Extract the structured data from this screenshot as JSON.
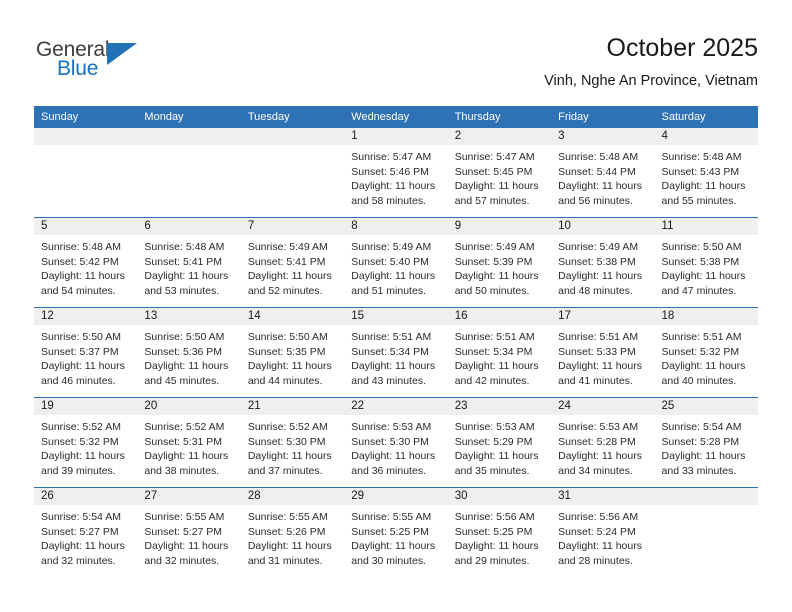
{
  "brand": {
    "name_part1": "General",
    "name_part2": "Blue"
  },
  "header": {
    "title": "October 2025",
    "location": "Vinh, Nghe An Province, Vietnam"
  },
  "colors": {
    "header_blue": "#2e71b5",
    "daynum_band": "#efefef",
    "logo_blue": "#1673c4",
    "text": "#1a1a1a"
  },
  "weekday_headers": [
    "Sunday",
    "Monday",
    "Tuesday",
    "Wednesday",
    "Thursday",
    "Friday",
    "Saturday"
  ],
  "labels": {
    "sunrise_prefix": "Sunrise:",
    "sunset_prefix": "Sunset:",
    "daylight_prefix": "Daylight:"
  },
  "weeks": [
    [
      {
        "day": "",
        "sunrise": "",
        "sunset": "",
        "daylight_line1": "",
        "daylight_line2": ""
      },
      {
        "day": "",
        "sunrise": "",
        "sunset": "",
        "daylight_line1": "",
        "daylight_line2": ""
      },
      {
        "day": "",
        "sunrise": "",
        "sunset": "",
        "daylight_line1": "",
        "daylight_line2": ""
      },
      {
        "day": "1",
        "sunrise": "Sunrise: 5:47 AM",
        "sunset": "Sunset: 5:46 PM",
        "daylight_line1": "Daylight: 11 hours",
        "daylight_line2": "and 58 minutes."
      },
      {
        "day": "2",
        "sunrise": "Sunrise: 5:47 AM",
        "sunset": "Sunset: 5:45 PM",
        "daylight_line1": "Daylight: 11 hours",
        "daylight_line2": "and 57 minutes."
      },
      {
        "day": "3",
        "sunrise": "Sunrise: 5:48 AM",
        "sunset": "Sunset: 5:44 PM",
        "daylight_line1": "Daylight: 11 hours",
        "daylight_line2": "and 56 minutes."
      },
      {
        "day": "4",
        "sunrise": "Sunrise: 5:48 AM",
        "sunset": "Sunset: 5:43 PM",
        "daylight_line1": "Daylight: 11 hours",
        "daylight_line2": "and 55 minutes."
      }
    ],
    [
      {
        "day": "5",
        "sunrise": "Sunrise: 5:48 AM",
        "sunset": "Sunset: 5:42 PM",
        "daylight_line1": "Daylight: 11 hours",
        "daylight_line2": "and 54 minutes."
      },
      {
        "day": "6",
        "sunrise": "Sunrise: 5:48 AM",
        "sunset": "Sunset: 5:41 PM",
        "daylight_line1": "Daylight: 11 hours",
        "daylight_line2": "and 53 minutes."
      },
      {
        "day": "7",
        "sunrise": "Sunrise: 5:49 AM",
        "sunset": "Sunset: 5:41 PM",
        "daylight_line1": "Daylight: 11 hours",
        "daylight_line2": "and 52 minutes."
      },
      {
        "day": "8",
        "sunrise": "Sunrise: 5:49 AM",
        "sunset": "Sunset: 5:40 PM",
        "daylight_line1": "Daylight: 11 hours",
        "daylight_line2": "and 51 minutes."
      },
      {
        "day": "9",
        "sunrise": "Sunrise: 5:49 AM",
        "sunset": "Sunset: 5:39 PM",
        "daylight_line1": "Daylight: 11 hours",
        "daylight_line2": "and 50 minutes."
      },
      {
        "day": "10",
        "sunrise": "Sunrise: 5:49 AM",
        "sunset": "Sunset: 5:38 PM",
        "daylight_line1": "Daylight: 11 hours",
        "daylight_line2": "and 48 minutes."
      },
      {
        "day": "11",
        "sunrise": "Sunrise: 5:50 AM",
        "sunset": "Sunset: 5:38 PM",
        "daylight_line1": "Daylight: 11 hours",
        "daylight_line2": "and 47 minutes."
      }
    ],
    [
      {
        "day": "12",
        "sunrise": "Sunrise: 5:50 AM",
        "sunset": "Sunset: 5:37 PM",
        "daylight_line1": "Daylight: 11 hours",
        "daylight_line2": "and 46 minutes."
      },
      {
        "day": "13",
        "sunrise": "Sunrise: 5:50 AM",
        "sunset": "Sunset: 5:36 PM",
        "daylight_line1": "Daylight: 11 hours",
        "daylight_line2": "and 45 minutes."
      },
      {
        "day": "14",
        "sunrise": "Sunrise: 5:50 AM",
        "sunset": "Sunset: 5:35 PM",
        "daylight_line1": "Daylight: 11 hours",
        "daylight_line2": "and 44 minutes."
      },
      {
        "day": "15",
        "sunrise": "Sunrise: 5:51 AM",
        "sunset": "Sunset: 5:34 PM",
        "daylight_line1": "Daylight: 11 hours",
        "daylight_line2": "and 43 minutes."
      },
      {
        "day": "16",
        "sunrise": "Sunrise: 5:51 AM",
        "sunset": "Sunset: 5:34 PM",
        "daylight_line1": "Daylight: 11 hours",
        "daylight_line2": "and 42 minutes."
      },
      {
        "day": "17",
        "sunrise": "Sunrise: 5:51 AM",
        "sunset": "Sunset: 5:33 PM",
        "daylight_line1": "Daylight: 11 hours",
        "daylight_line2": "and 41 minutes."
      },
      {
        "day": "18",
        "sunrise": "Sunrise: 5:51 AM",
        "sunset": "Sunset: 5:32 PM",
        "daylight_line1": "Daylight: 11 hours",
        "daylight_line2": "and 40 minutes."
      }
    ],
    [
      {
        "day": "19",
        "sunrise": "Sunrise: 5:52 AM",
        "sunset": "Sunset: 5:32 PM",
        "daylight_line1": "Daylight: 11 hours",
        "daylight_line2": "and 39 minutes."
      },
      {
        "day": "20",
        "sunrise": "Sunrise: 5:52 AM",
        "sunset": "Sunset: 5:31 PM",
        "daylight_line1": "Daylight: 11 hours",
        "daylight_line2": "and 38 minutes."
      },
      {
        "day": "21",
        "sunrise": "Sunrise: 5:52 AM",
        "sunset": "Sunset: 5:30 PM",
        "daylight_line1": "Daylight: 11 hours",
        "daylight_line2": "and 37 minutes."
      },
      {
        "day": "22",
        "sunrise": "Sunrise: 5:53 AM",
        "sunset": "Sunset: 5:30 PM",
        "daylight_line1": "Daylight: 11 hours",
        "daylight_line2": "and 36 minutes."
      },
      {
        "day": "23",
        "sunrise": "Sunrise: 5:53 AM",
        "sunset": "Sunset: 5:29 PM",
        "daylight_line1": "Daylight: 11 hours",
        "daylight_line2": "and 35 minutes."
      },
      {
        "day": "24",
        "sunrise": "Sunrise: 5:53 AM",
        "sunset": "Sunset: 5:28 PM",
        "daylight_line1": "Daylight: 11 hours",
        "daylight_line2": "and 34 minutes."
      },
      {
        "day": "25",
        "sunrise": "Sunrise: 5:54 AM",
        "sunset": "Sunset: 5:28 PM",
        "daylight_line1": "Daylight: 11 hours",
        "daylight_line2": "and 33 minutes."
      }
    ],
    [
      {
        "day": "26",
        "sunrise": "Sunrise: 5:54 AM",
        "sunset": "Sunset: 5:27 PM",
        "daylight_line1": "Daylight: 11 hours",
        "daylight_line2": "and 32 minutes."
      },
      {
        "day": "27",
        "sunrise": "Sunrise: 5:55 AM",
        "sunset": "Sunset: 5:27 PM",
        "daylight_line1": "Daylight: 11 hours",
        "daylight_line2": "and 32 minutes."
      },
      {
        "day": "28",
        "sunrise": "Sunrise: 5:55 AM",
        "sunset": "Sunset: 5:26 PM",
        "daylight_line1": "Daylight: 11 hours",
        "daylight_line2": "and 31 minutes."
      },
      {
        "day": "29",
        "sunrise": "Sunrise: 5:55 AM",
        "sunset": "Sunset: 5:25 PM",
        "daylight_line1": "Daylight: 11 hours",
        "daylight_line2": "and 30 minutes."
      },
      {
        "day": "30",
        "sunrise": "Sunrise: 5:56 AM",
        "sunset": "Sunset: 5:25 PM",
        "daylight_line1": "Daylight: 11 hours",
        "daylight_line2": "and 29 minutes."
      },
      {
        "day": "31",
        "sunrise": "Sunrise: 5:56 AM",
        "sunset": "Sunset: 5:24 PM",
        "daylight_line1": "Daylight: 11 hours",
        "daylight_line2": "and 28 minutes."
      },
      {
        "day": "",
        "sunrise": "",
        "sunset": "",
        "daylight_line1": "",
        "daylight_line2": ""
      }
    ]
  ]
}
